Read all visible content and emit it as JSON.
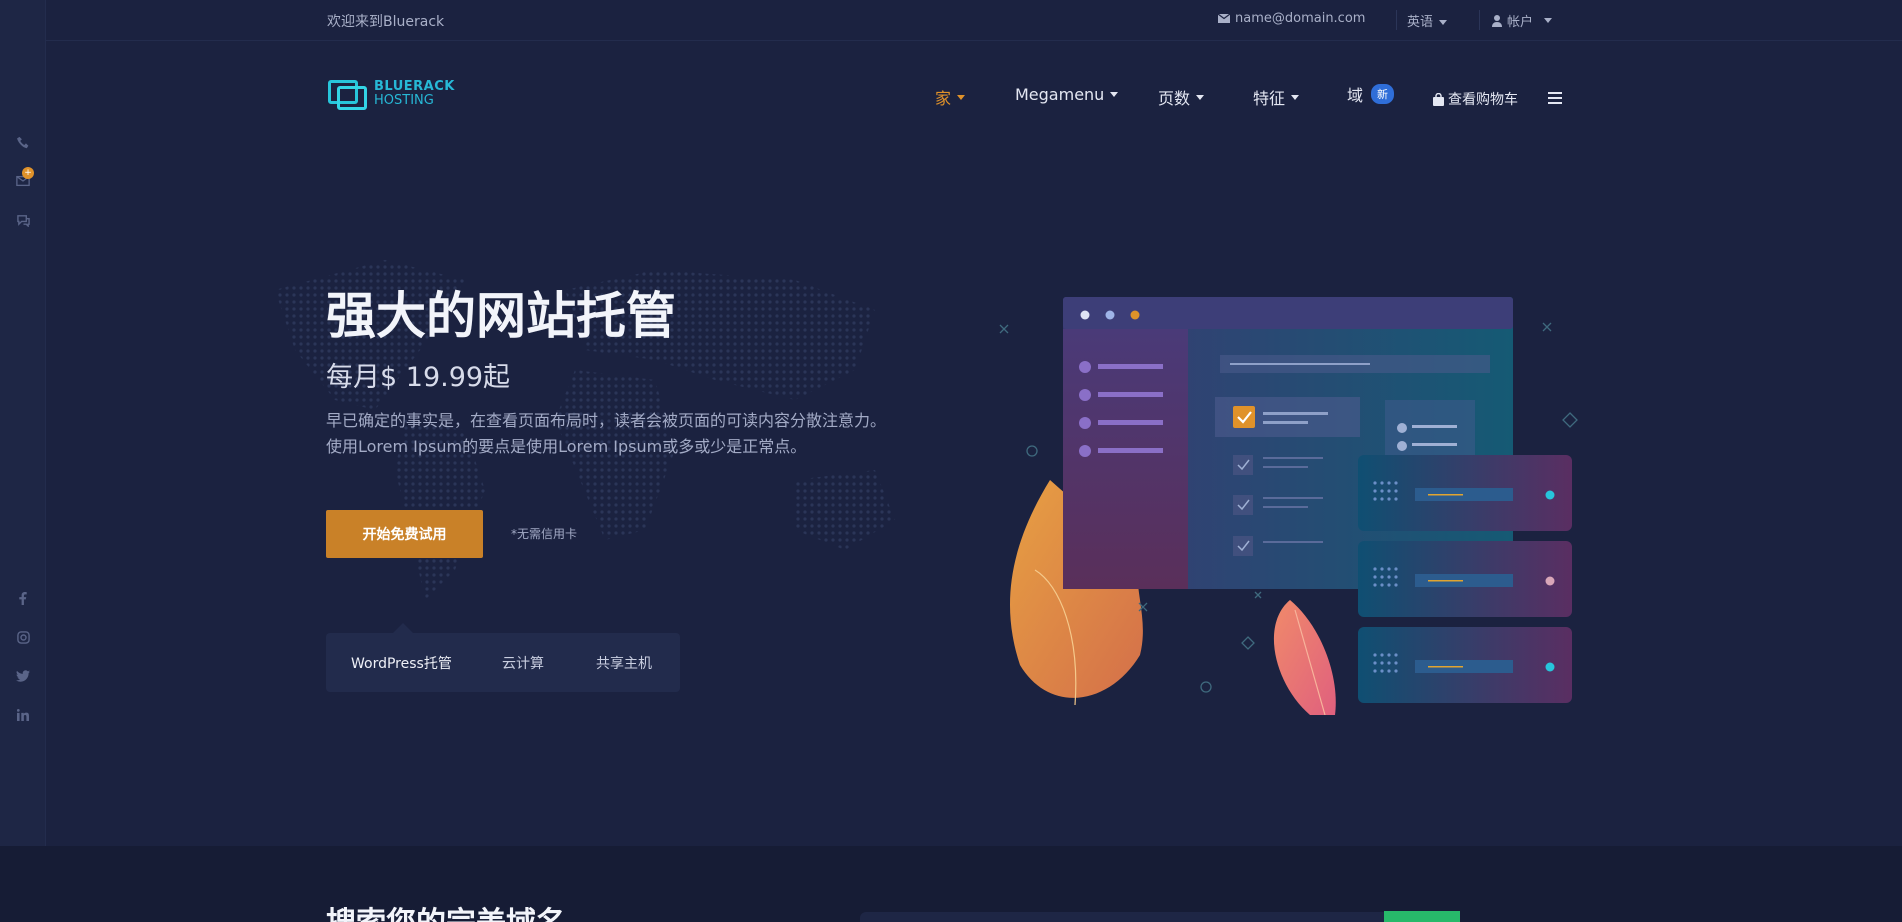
{
  "topbar": {
    "welcome": "欢迎来到Bluerack",
    "email": "name@domain.com",
    "language": "英语",
    "account": "帐户"
  },
  "logo": {
    "line1": "BLUERACK",
    "line2": "HOSTING"
  },
  "nav": {
    "items": [
      {
        "label": "家",
        "active": true
      },
      {
        "label": "Megamenu"
      },
      {
        "label": "页数"
      },
      {
        "label": "特征"
      },
      {
        "label": "域",
        "badge": "新"
      }
    ],
    "cart": "查看购物车"
  },
  "hero": {
    "title": "强大的网站托管",
    "price": "每月$ 19.99起",
    "desc1": "早已确定的事实是，在查看页面布局时，读者会被页面的可读内容分散注意力。",
    "desc2": "使用Lorem Ipsum的要点是使用Lorem Ipsum或多或少是正常点。",
    "cta": "开始免费试用",
    "note": "*无需信用卡"
  },
  "tabs": [
    "WordPress托管",
    "云计算",
    "共享主机"
  ],
  "domain_search": {
    "title": "搜索您的完美域名"
  },
  "colors": {
    "accent": "#c98128",
    "background": "#1b2240",
    "brand": "#27b8d6"
  }
}
